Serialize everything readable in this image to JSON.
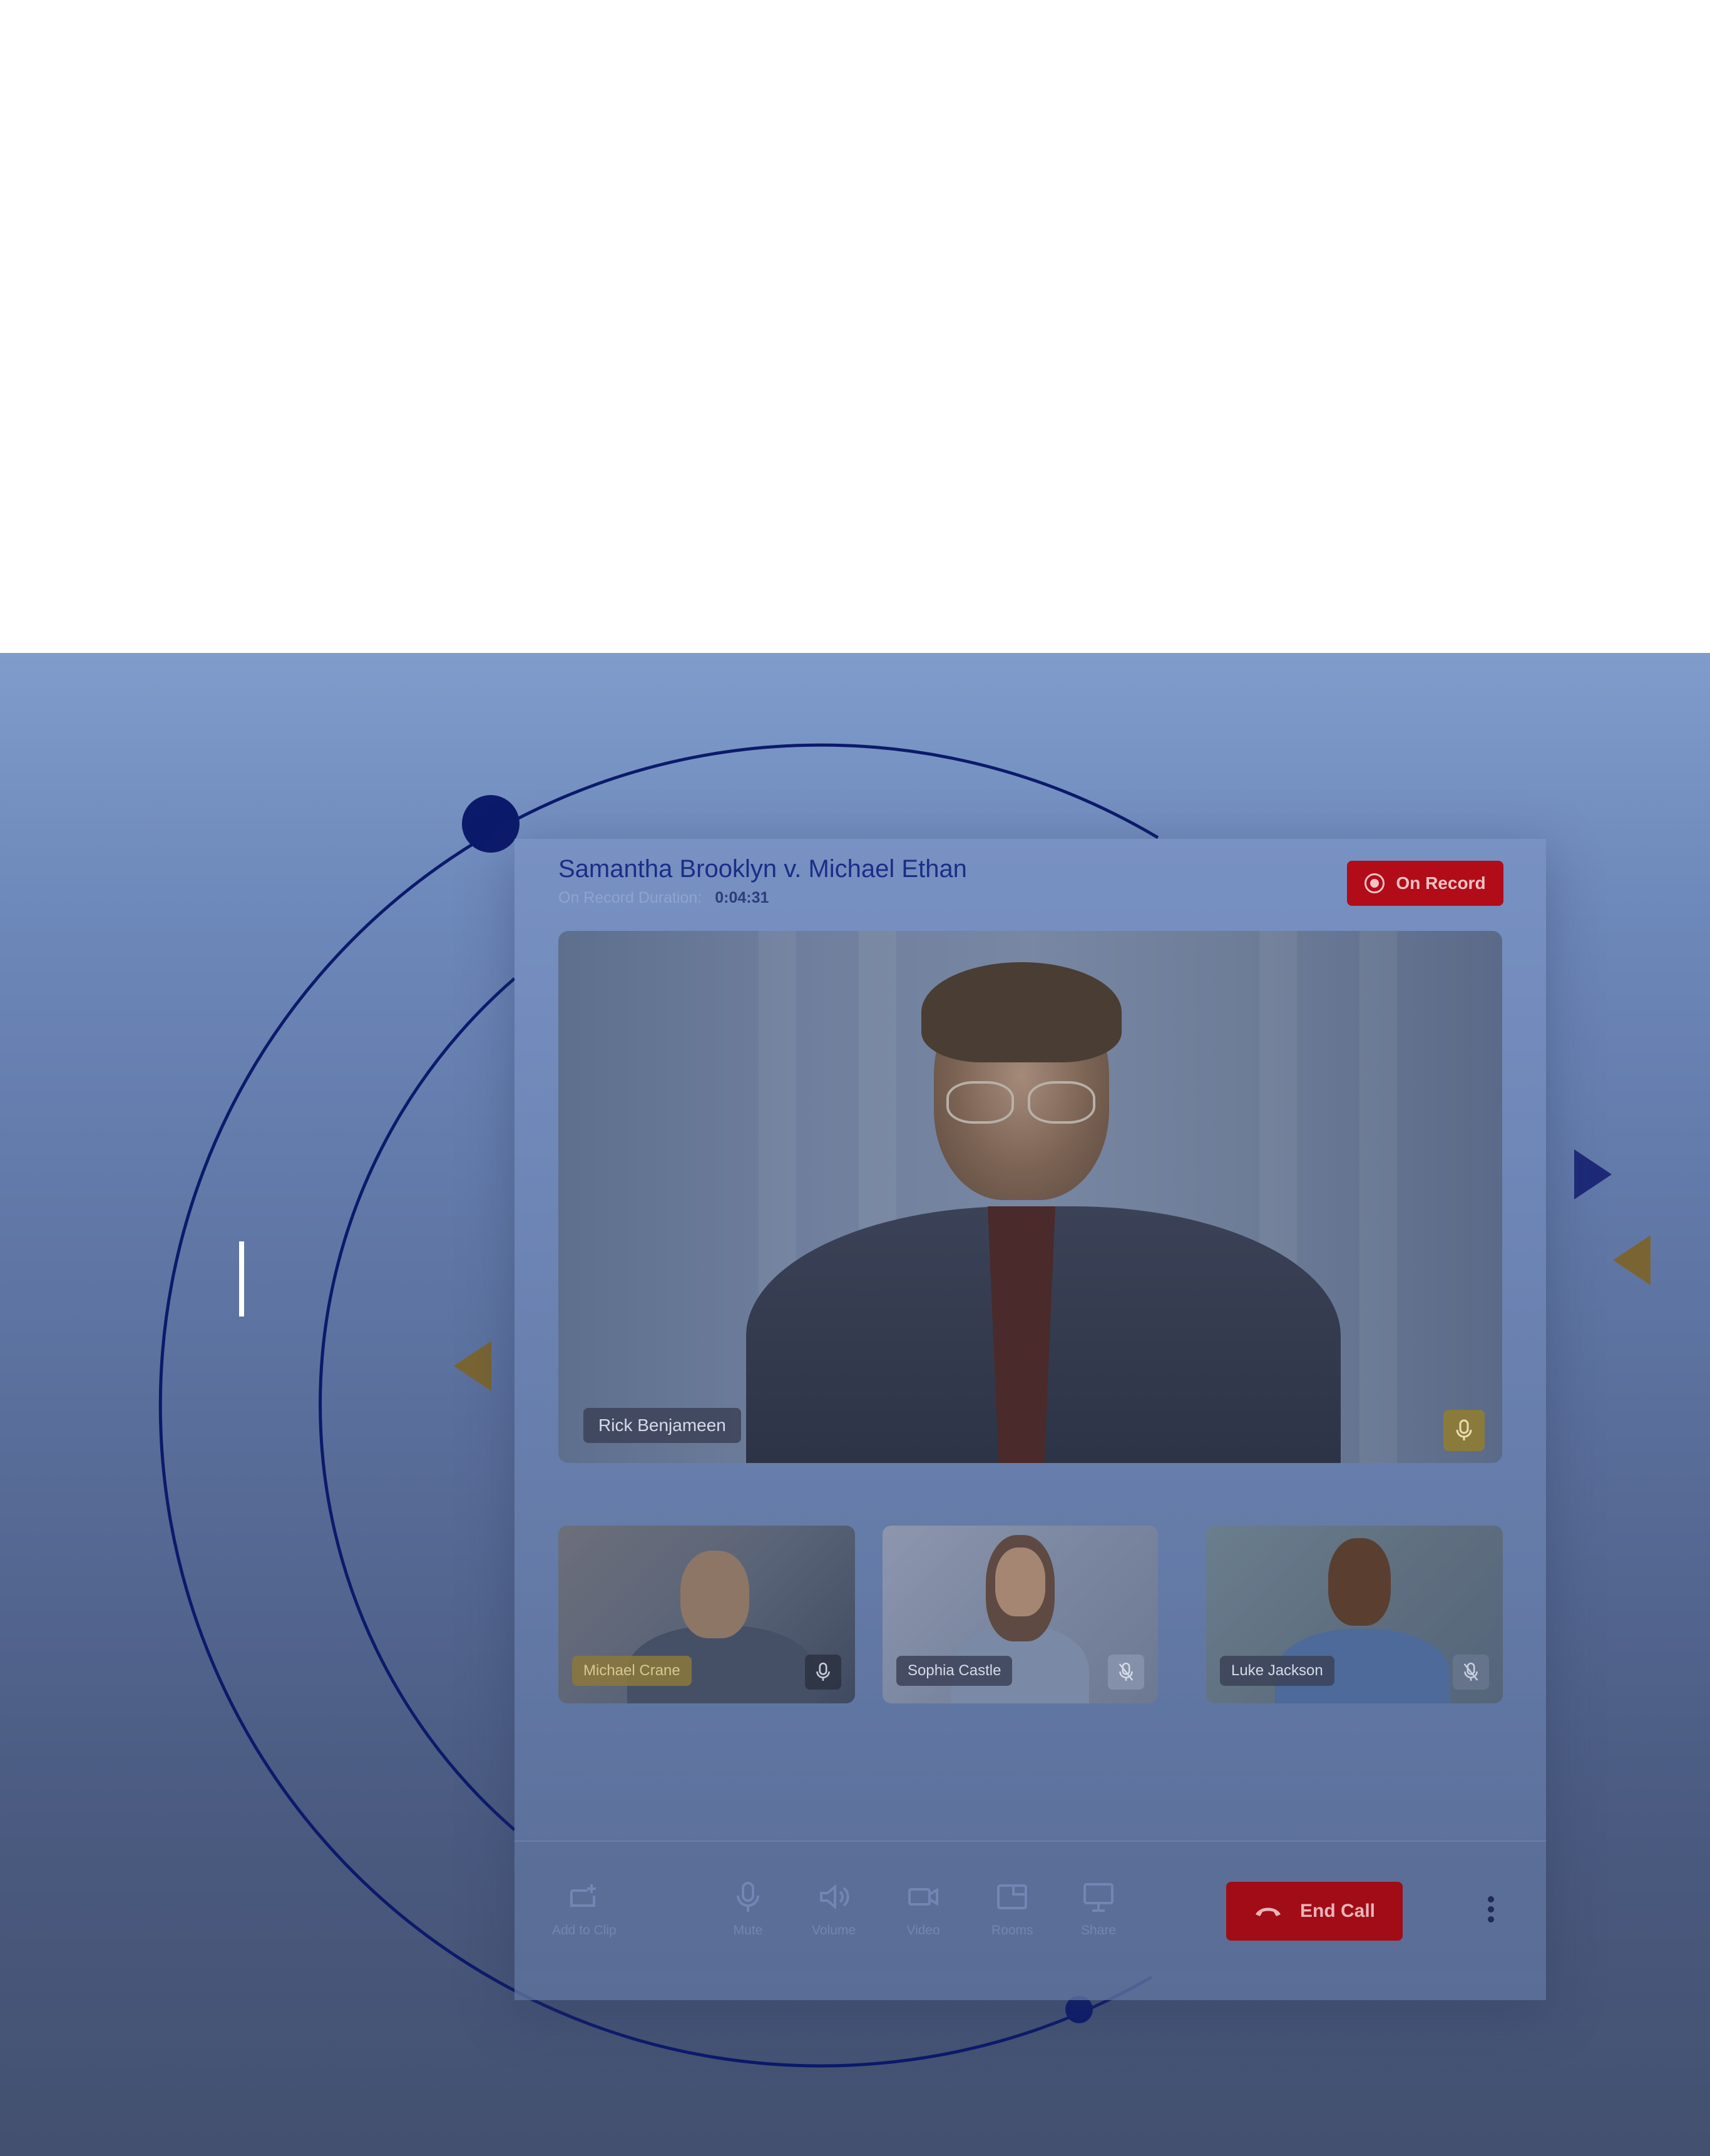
{
  "call": {
    "title": "Samantha Brooklyn v. Michael Ethan",
    "duration_label": "On Record Duration:",
    "duration_value": "0:04:31",
    "record_label": "On Record"
  },
  "main_speaker": {
    "name": "Rick Benjameen",
    "mic_icon": "mic-icon"
  },
  "participants": [
    {
      "name": "Michael Crane",
      "mic_icon": "mic-icon"
    },
    {
      "name": "Sophia Castle",
      "mic_icon": "mic-off-icon"
    },
    {
      "name": "Luke Jackson",
      "mic_icon": "mic-off-icon"
    }
  ],
  "toolbar": {
    "add_to_clip": "Add to Clip",
    "mute": "Mute",
    "volume": "Volume",
    "video": "Video",
    "rooms": "Rooms",
    "share": "Share",
    "end_call": "End Call"
  },
  "colors": {
    "accent": "#1a2e86",
    "record_red": "#b10c18",
    "end_call_red": "#a10c17",
    "gold": "#7a6532"
  }
}
